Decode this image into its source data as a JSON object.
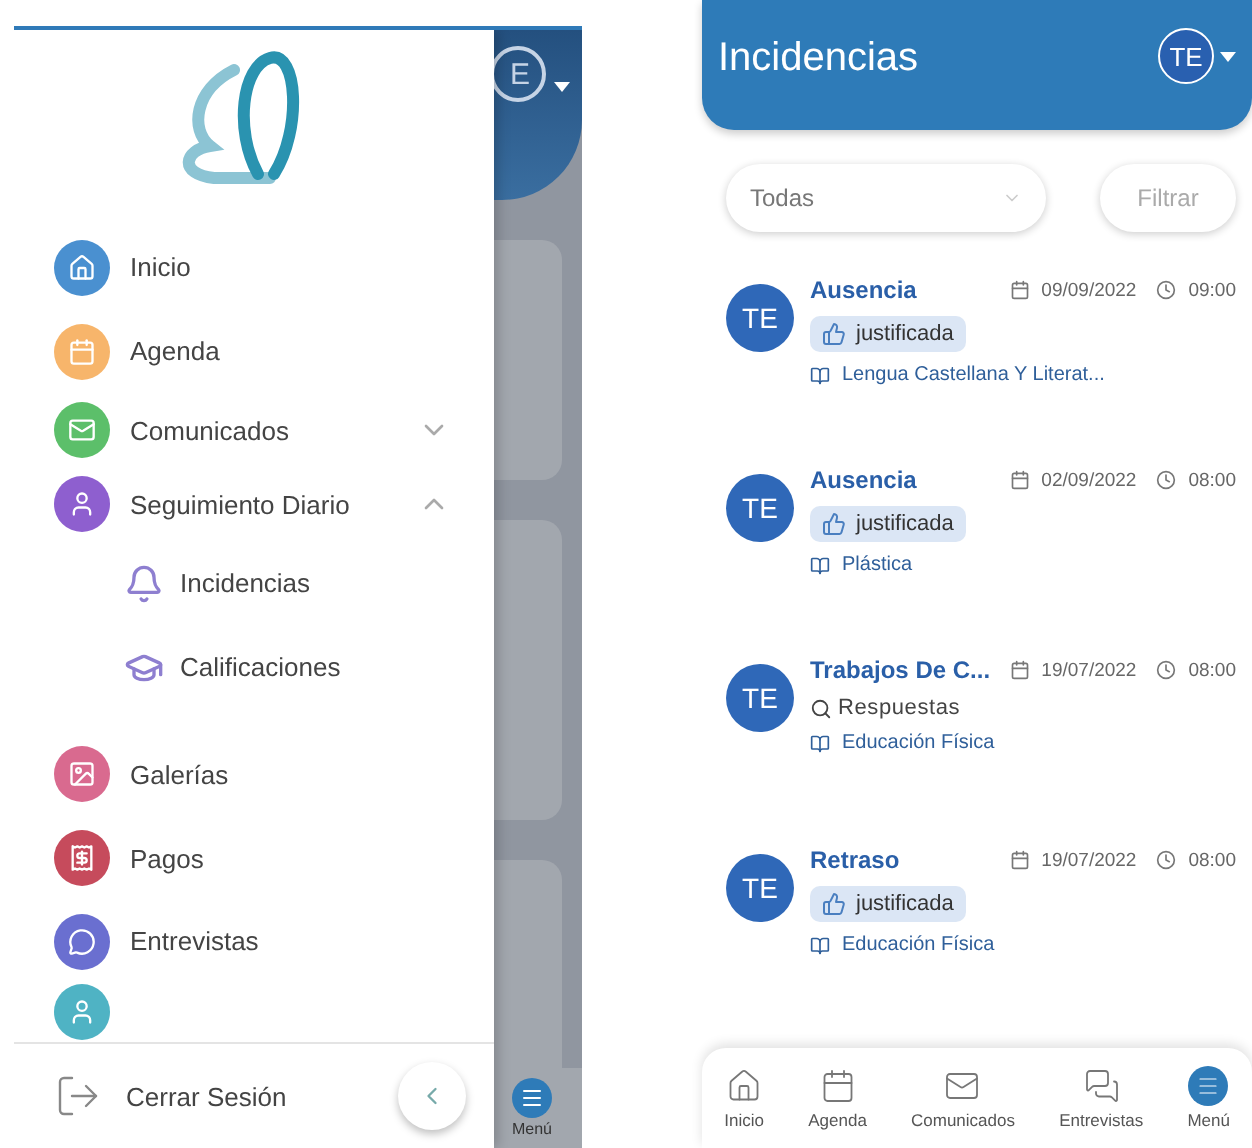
{
  "left_screen": {
    "background_app": {
      "avatar": "E",
      "nav_label": "Menú"
    },
    "drawer": {
      "menu": [
        {
          "label": "Inicio",
          "kind": "item",
          "color": "#4a90d0"
        },
        {
          "label": "Agenda",
          "kind": "item",
          "color": "#f7b56b"
        },
        {
          "label": "Comunicados",
          "kind": "group",
          "color": "#5cbf6a",
          "expanded": false
        },
        {
          "label": "Seguimiento Diario",
          "kind": "group",
          "color": "#8e5fcf",
          "expanded": true,
          "children": [
            {
              "label": "Incidencias"
            },
            {
              "label": "Calificaciones"
            }
          ]
        },
        {
          "label": "Galerías",
          "kind": "item",
          "color": "#d96a8f"
        },
        {
          "label": "Pagos",
          "kind": "item",
          "color": "#c64b5c"
        },
        {
          "label": "Entrevistas",
          "kind": "item",
          "color": "#6a6fd0"
        },
        {
          "kind": "cut",
          "color": "#4fb3c4"
        }
      ],
      "footer": {
        "label": "Cerrar Sesión"
      }
    }
  },
  "right_screen": {
    "header": {
      "title": "Incidencias",
      "avatar": "TE"
    },
    "filter": {
      "value": "Todas"
    },
    "filter_button": "Filtrar",
    "items": [
      {
        "kind": "justified",
        "avatar": "TE",
        "title": "Ausencia",
        "date": "09/09/2022",
        "time": "09:00",
        "tag": "justificada",
        "subject": "Lengua Castellana Y Literat..."
      },
      {
        "kind": "justified",
        "avatar": "TE",
        "title": "Ausencia",
        "date": "02/09/2022",
        "time": "08:00",
        "tag": "justificada",
        "subject": "Plástica"
      },
      {
        "kind": "responses",
        "avatar": "TE",
        "title": "Trabajos De C...",
        "date": "19/07/2022",
        "time": "08:00",
        "tag": "Respuestas",
        "subject": "Educación Física"
      },
      {
        "kind": "justified",
        "avatar": "TE",
        "title": "Retraso",
        "date": "19/07/2022",
        "time": "08:00",
        "tag": "justificada",
        "subject": "Educación Física"
      }
    ],
    "bottom_nav": [
      {
        "label": "Inicio",
        "selected": false
      },
      {
        "label": "Agenda",
        "selected": false
      },
      {
        "label": "Comunicados",
        "selected": false
      },
      {
        "label": "Entrevistas",
        "selected": false
      },
      {
        "label": "Menú",
        "selected": true
      }
    ]
  }
}
